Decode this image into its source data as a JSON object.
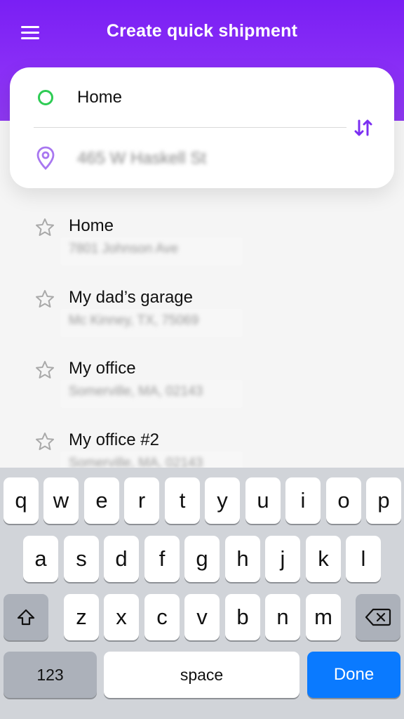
{
  "header": {
    "title": "Create quick shipment"
  },
  "route": {
    "origin": "Home",
    "destination": "465 W Haskell St"
  },
  "places": [
    {
      "name": "Home",
      "address": "7801 Johnson Ave"
    },
    {
      "name": "My dad’s garage",
      "address": "Mc Kinney, TX, 75069"
    },
    {
      "name": "My office",
      "address": "Somerville, MA, 02143"
    },
    {
      "name": "My office #2",
      "address": "Somerville, MA, 02143"
    }
  ],
  "keyboard": {
    "row1": [
      "q",
      "w",
      "e",
      "r",
      "t",
      "y",
      "u",
      "i",
      "o",
      "p"
    ],
    "row2": [
      "a",
      "s",
      "d",
      "f",
      "g",
      "h",
      "j",
      "k",
      "l"
    ],
    "row3": [
      "z",
      "x",
      "c",
      "v",
      "b",
      "n",
      "m"
    ],
    "numbers_label": "123",
    "space_label": "space",
    "done_label": "Done"
  },
  "colors": {
    "header": "#7a1ff4",
    "accent": "#7b2ff2",
    "origin_green": "#2ecc54",
    "done_blue": "#0a7aff"
  }
}
